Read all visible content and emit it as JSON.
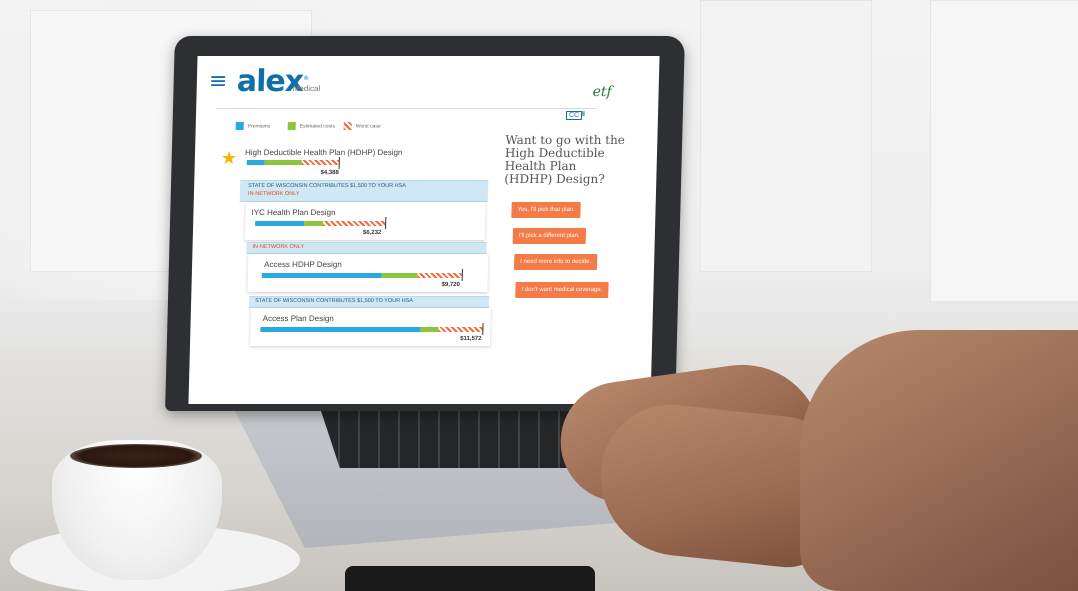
{
  "app": {
    "brand": "alex",
    "brand_mark": "®",
    "section": "Medical",
    "partner_logo": "etf",
    "menu_icon": "≡",
    "cc_label": "CC",
    "pause_label": "II"
  },
  "legend": [
    {
      "label": "Premiums",
      "swatch": "blue"
    },
    {
      "label": "Estimated costs",
      "swatch": "green"
    },
    {
      "label": "Worst case",
      "swatch": "hatch"
    }
  ],
  "plans": [
    {
      "name": "High Deductible Health Plan (HDHP) Design",
      "cost": "$4,388",
      "starred": true,
      "breakdown": {
        "premiums": 0.2,
        "estimated": 0.4,
        "worst_case": 0.4
      }
    },
    {
      "name": "IYC Health Plan Design",
      "cost": "$6,232",
      "breakdown": {
        "premiums": 0.38,
        "estimated": 0.14,
        "worst_case": 0.48
      }
    },
    {
      "name": "Access HDHP Design",
      "cost": "$9,720",
      "breakdown": {
        "premiums": 0.6,
        "estimated": 0.18,
        "worst_case": 0.22
      }
    },
    {
      "name": "Access Plan Design",
      "cost": "$11,572",
      "breakdown": {
        "premiums": 0.72,
        "estimated": 0.08,
        "worst_case": 0.2
      }
    }
  ],
  "banners": {
    "hsa_1": "STATE OF WISCONSIN CONTRIBUTES $1,500 TO YOUR HSA",
    "in_network_1": "IN-NETWORK ONLY",
    "in_network_2": "IN-NETWORK ONLY",
    "hsa_2": "STATE OF WISCONSIN CONTRIBUTES $1,500 TO YOUR HSA"
  },
  "question": "Want to go with the High Deductible Health Plan (HDHP) Design?",
  "choices": [
    "Yes, I'll pick that plan.",
    "I'll pick a different plan.",
    "I need more info to decide.",
    "I don't want medical coverage."
  ],
  "colors": {
    "brand": "#0f6fa8",
    "premiums": "#2aa9e0",
    "estimated": "#8cc63e",
    "worst_case": "#f26b3a",
    "choice_button": "#f47a48",
    "banner": "#cfe8f3",
    "star": "#f7b500"
  }
}
